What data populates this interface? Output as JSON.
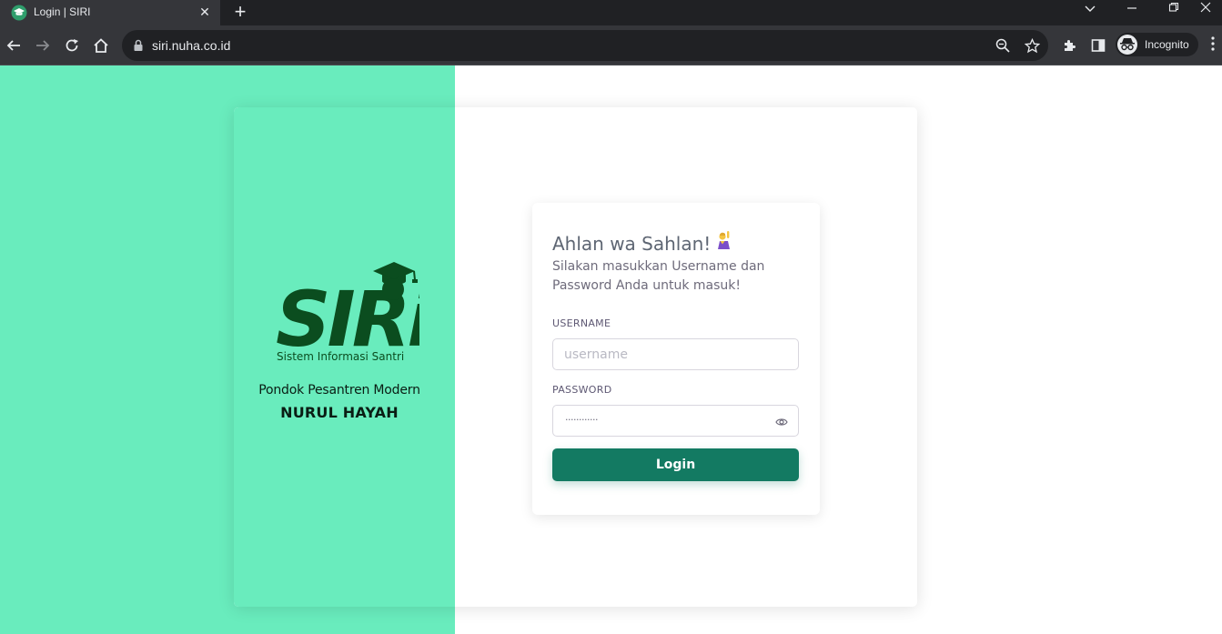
{
  "browser": {
    "tab_title": "Login | SIRI",
    "url": "siri.nuha.co.id",
    "profile_label": "Incognito"
  },
  "brand": {
    "logo_text": "SIRi",
    "logo_subtitle": "Sistem Informasi Santri",
    "school_line1": "Pondok Pesantren Modern",
    "school_line2": "NURUL HAYAH"
  },
  "login": {
    "greeting": "Ahlan wa Sahlan!",
    "subtitle": "Silakan masukkan Username dan Password Anda untuk masuk!",
    "username_label": "USERNAME",
    "username_placeholder": "username",
    "password_label": "PASSWORD",
    "password_value": "············",
    "button_label": "Login"
  },
  "colors": {
    "brand_mint": "#69ecbd",
    "primary_button": "#137a62",
    "logo_dark_green": "#0b4d1f"
  }
}
